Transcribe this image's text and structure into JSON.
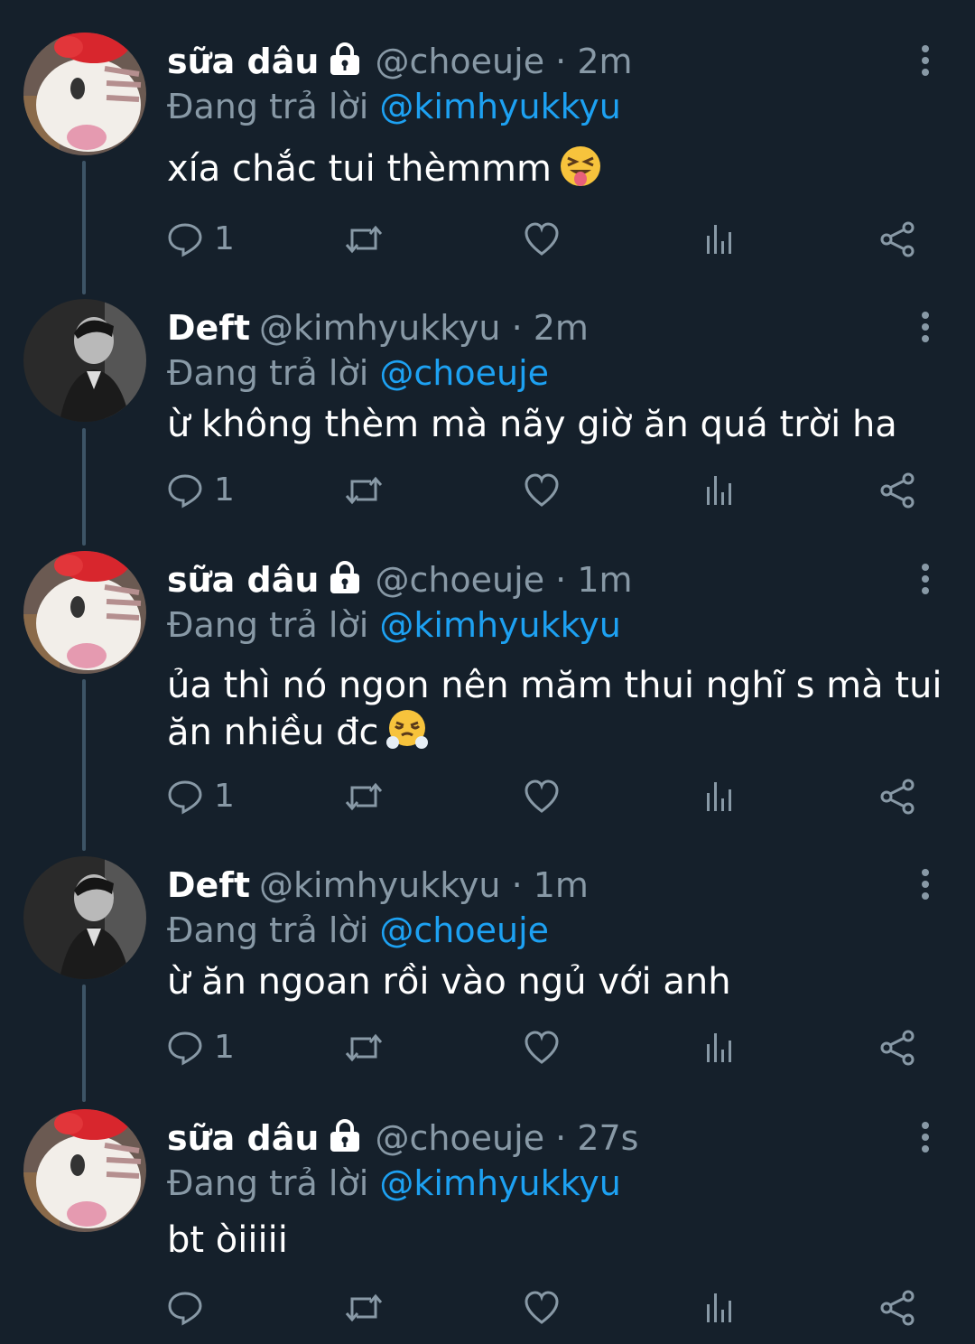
{
  "tweets": [
    {
      "name": "sữa dâu",
      "locked": true,
      "handle": "@choeuje",
      "time": "2m",
      "replying_label": "Đang trả lời",
      "replying_to": "@kimhyukkyu",
      "text": "xía chắc tui thèmmm",
      "emoji": "squinting-tongue",
      "reply_count": "1",
      "avatar": "hello-kitty"
    },
    {
      "name": "Deft",
      "locked": false,
      "handle": "@kimhyukkyu",
      "time": "2m",
      "replying_label": "Đang trả lời",
      "replying_to": "@choeuje",
      "text": "ừ không thèm mà nãy giờ ăn quá trời ha",
      "emoji": "",
      "reply_count": "1",
      "avatar": "person-monochrome"
    },
    {
      "name": "sữa dâu",
      "locked": true,
      "handle": "@choeuje",
      "time": "1m",
      "replying_label": "Đang trả lời",
      "replying_to": "@kimhyukkyu",
      "text": "ủa thì nó ngon nên măm thui nghĩ s mà tui ăn nhiều đc",
      "emoji": "steam-from-nose",
      "reply_count": "1",
      "avatar": "hello-kitty"
    },
    {
      "name": "Deft",
      "locked": false,
      "handle": "@kimhyukkyu",
      "time": "1m",
      "replying_label": "Đang trả lời",
      "replying_to": "@choeuje",
      "text": "ừ ăn ngoan rồi vào ngủ với anh",
      "emoji": "",
      "reply_count": "1",
      "avatar": "person-monochrome"
    },
    {
      "name": "sữa dâu",
      "locked": true,
      "handle": "@choeuje",
      "time": "27s",
      "replying_label": "Đang trả lời",
      "replying_to": "@kimhyukkyu",
      "text": "bt òiiiii",
      "emoji": "",
      "reply_count": "",
      "avatar": "hello-kitty"
    }
  ],
  "icons": {
    "reply": "reply-icon",
    "retweet": "retweet-icon",
    "like": "like-icon",
    "views": "views-icon",
    "share": "share-icon",
    "more": "more-icon",
    "lock": "lock-icon"
  },
  "colors": {
    "background": "#15202b",
    "text": "#ffffff",
    "secondary": "#8899a6",
    "mention": "#1da1f2",
    "thread_line": "#3d5466"
  }
}
